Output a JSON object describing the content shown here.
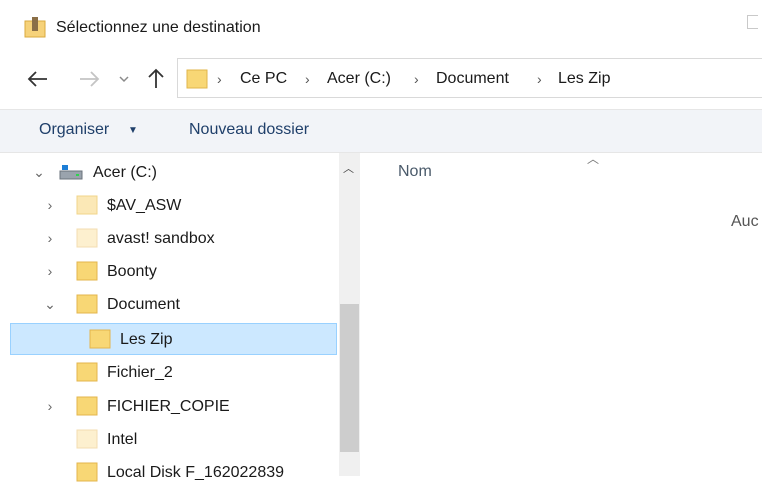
{
  "window": {
    "title": "Sélectionnez une destination"
  },
  "navigation": {
    "back_icon": "arrow-left-icon",
    "forward_icon": "arrow-right-icon",
    "recent_icon": "chevron-down-icon",
    "up_icon": "arrow-up-icon",
    "breadcrumbs": [
      "Ce PC",
      "Acer (C:)",
      "Document",
      "Les Zip"
    ]
  },
  "toolbar": {
    "organize_label": "Organiser",
    "new_folder_label": "Nouveau dossier"
  },
  "tree": {
    "items": [
      {
        "label": "Acer (C:)",
        "expander": "expanded",
        "icon": "drive-icon"
      },
      {
        "label": "$AV_ASW",
        "expander": "collapsed",
        "icon": "folder-icon"
      },
      {
        "label": "avast! sandbox",
        "expander": "collapsed",
        "icon": "folder-icon"
      },
      {
        "label": "Boonty",
        "expander": "collapsed",
        "icon": "folder-icon"
      },
      {
        "label": "Document",
        "expander": "expanded",
        "icon": "folder-icon"
      },
      {
        "label": "Les Zip",
        "expander": "none",
        "icon": "folder-icon",
        "selected": true
      },
      {
        "label": "Fichier_2",
        "expander": "none",
        "icon": "folder-icon"
      },
      {
        "label": "FICHIER_COPIE",
        "expander": "collapsed",
        "icon": "folder-icon"
      },
      {
        "label": "Intel",
        "expander": "none",
        "icon": "folder-icon"
      },
      {
        "label": "Local Disk F_162022839",
        "expander": "none",
        "icon": "folder-icon"
      }
    ]
  },
  "content": {
    "column_name": "Nom",
    "empty_message": "Auc"
  },
  "colors": {
    "selection_bg": "#cce8ff",
    "selection_border": "#99d1ff",
    "folder": "#f8d775",
    "command_bar_bg": "#f2f4f8"
  }
}
